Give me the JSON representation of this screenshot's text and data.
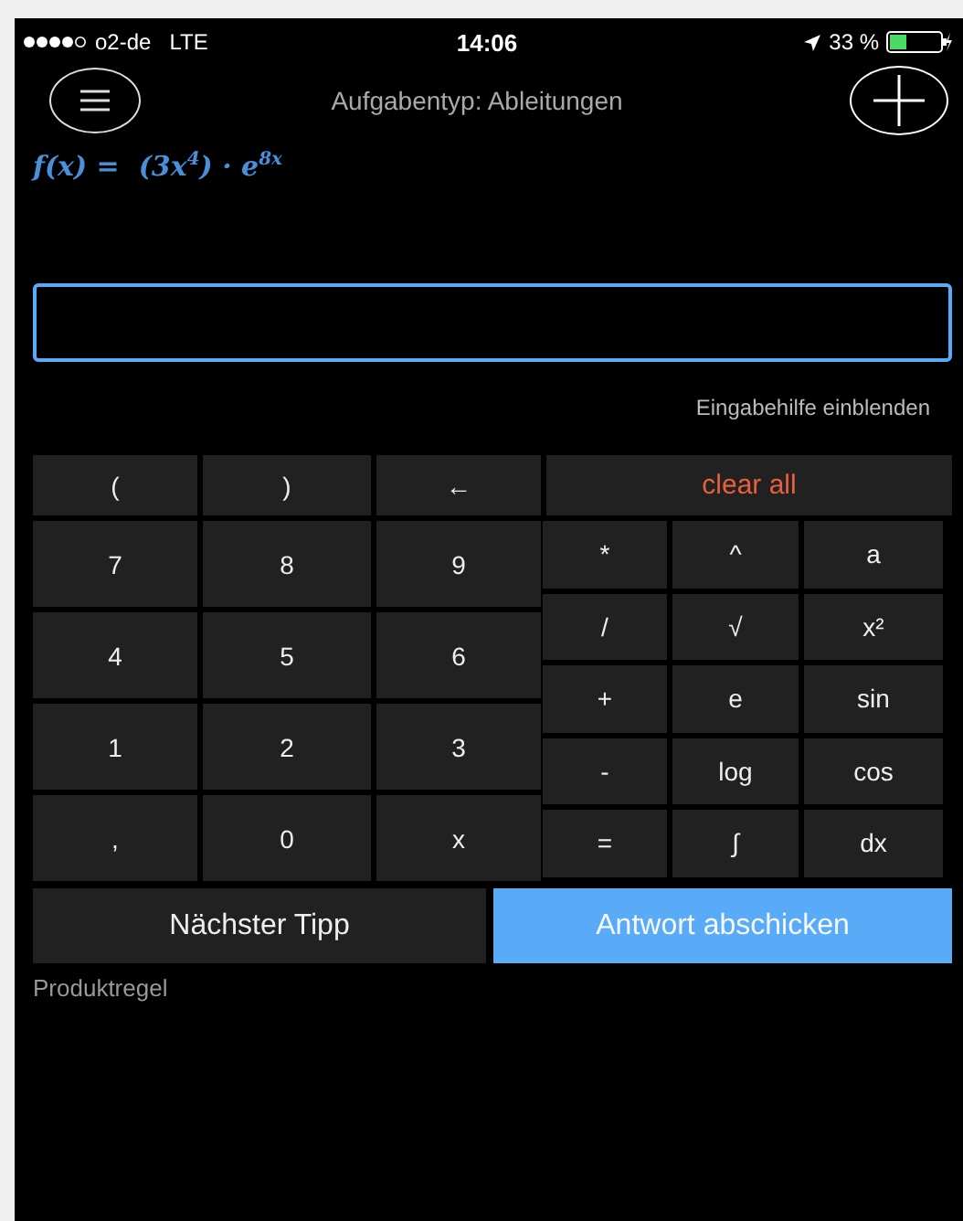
{
  "status_bar": {
    "carrier": "o2-de",
    "network": "LTE",
    "time": "14:06",
    "battery": "33 %"
  },
  "header": {
    "title": "Aufgabentyp: Ableitungen"
  },
  "formula": "f(x) =  (3x$^{4}$) · e$^{8x}$",
  "hint_toggle": "Eingabehilfe einblenden",
  "top_keys": [
    {
      "label": "(",
      "kind": "key"
    },
    {
      "label": ")",
      "kind": "key"
    },
    {
      "label": "←",
      "kind": "key"
    },
    {
      "label": "clear all",
      "kind": "clear"
    }
  ],
  "number_keys": [
    "7",
    "8",
    "9",
    "4",
    "5",
    "6",
    "1",
    "2",
    "3",
    ",",
    "0",
    "x"
  ],
  "function_keys": [
    "*",
    "^",
    "a",
    "/",
    "√",
    "x²",
    "+",
    "e",
    "sin",
    "-",
    "log",
    "cos",
    "=",
    "∫",
    "dx"
  ],
  "buttons": [
    {
      "label": "Nächster Tipp",
      "kind": "secondary"
    },
    {
      "label": "Antwort abschicken",
      "kind": "primary"
    }
  ],
  "hint_text": "Produktregel"
}
